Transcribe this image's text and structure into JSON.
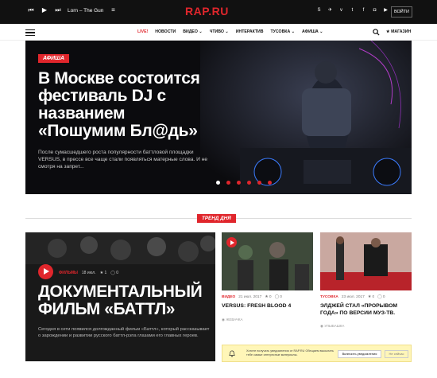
{
  "topbar": {
    "now_playing": "Lorn – The Gun",
    "logo": "RAP.RU",
    "login_label": "ВОЙТИ"
  },
  "nav": {
    "items": [
      "LIVE!",
      "НОВОСТИ",
      "ВИДЕО",
      "ЧТИВО",
      "ИНТЕРАКТИВ",
      "ТУСОВКА",
      "АФИША"
    ],
    "shop_label": "МАГАЗИН"
  },
  "hero": {
    "badge": "АФИША",
    "title": "В Москве состоится фестиваль DJ с названием «Пошумим Бл@дь»",
    "lead": "После сумасшедшего роста популярности баттловой площадки VERSUS, в прессе все чаще стали появляться матерные слова. И не смотря на запрет..."
  },
  "trend_label": "ТРЕНД ДНЯ",
  "cards": {
    "main": {
      "category": "ФИЛЬМЫ",
      "date": "18 июл.",
      "likes": "1",
      "comments": "0",
      "title": "ДОКУМЕНТАЛЬНЫЙ ФИЛЬМ «БАТТЛ»",
      "lead": "Сегодня в сети появился долгожданный фильм «Баттл», который рассказывает о зарождении и развитии русского баттл-рэпа глазами его главных героев."
    },
    "second": {
      "category": "ВИДЕО",
      "date": "21 июл. 2017",
      "likes": "0",
      "comments": "0",
      "title": "VERSUS: FRESH BLOOD 4",
      "author": "ЖЕВАЧКА"
    },
    "third": {
      "category": "ТУСОВКА",
      "date": "23 июл. 2017",
      "likes": "0",
      "comments": "0",
      "title": "ЭЛДЖЕЙ СТАЛ «ПРОРЫВОМ ГОДА» ПО ВЕРСИИ МУЗ-ТВ.",
      "author": "УЛЫБАШКА"
    }
  },
  "notify": {
    "text": "Хотите получать уведомления от RAP.RU Обещаем высылать тебе самые интересные материалы.",
    "enable_label": "Включить уведомления",
    "later_label": "Не сейчас"
  },
  "colors": {
    "accent": "#e0262c",
    "dark": "#111111",
    "notify_bg": "#fff6b8"
  }
}
